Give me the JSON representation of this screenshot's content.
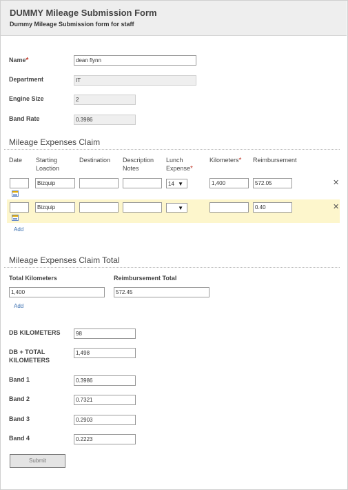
{
  "form": {
    "title": "DUMMY Mileage Submission Form",
    "subtitle": "Dummy Mileage Submission form for staff"
  },
  "fields": {
    "name": {
      "label": "Name",
      "value": "dean flynn",
      "required_mark": "*"
    },
    "department": {
      "label": "Department",
      "value": "IT"
    },
    "engine_size": {
      "label": "Engine Size",
      "value": "2"
    },
    "band_rate": {
      "label": "Band Rate",
      "value": "0.3986"
    }
  },
  "claim": {
    "title": "Mileage Expenses Claim",
    "columns": {
      "date": "Date",
      "starting_location_1": "Starting",
      "starting_location_2": "Loaction",
      "destination": "Destination",
      "description_1": "Description",
      "description_2": "Notes",
      "lunch_1": "Lunch",
      "lunch_2": "Expense",
      "kilometers": "Kilometers",
      "reimbursement": "Reimbursement",
      "required_mark": "*"
    },
    "rows": [
      {
        "date": "",
        "starting": "Bizquip",
        "destination": "",
        "description": "",
        "lunch": "14",
        "kilometers": "1,400",
        "reimbursement": "572.05",
        "delete": "✕"
      },
      {
        "date": "",
        "starting": "Bizquip",
        "destination": "",
        "description": "",
        "lunch": "",
        "kilometers": "",
        "reimbursement": "0.40",
        "delete": "✕"
      }
    ],
    "add_label": "Add"
  },
  "totals": {
    "title": "Mileage Expenses Claim Total",
    "total_km_label": "Total Kilometers",
    "total_km_value": "1,400",
    "reimb_total_label": "Reimbursement Total",
    "reimb_total_value": "572.45",
    "add_label": "Add"
  },
  "extra": {
    "db_km_label": "DB KILOMETERS",
    "db_km_value": "98",
    "db_total_label_1": "DB + TOTAL",
    "db_total_label_2": "KILOMETERS",
    "db_total_value": "1,498",
    "band1_label": "Band 1",
    "band1_value": "0.3986",
    "band2_label": "Band 2",
    "band2_value": "0.7321",
    "band3_label": "Band 3",
    "band3_value": "0.2903",
    "band4_label": "Band 4",
    "band4_value": "0.2223"
  },
  "submit_label": "Submit",
  "icons": {
    "calendar": "calendar-icon",
    "delete": "close-icon",
    "dropdown": "chevron-down-icon"
  }
}
